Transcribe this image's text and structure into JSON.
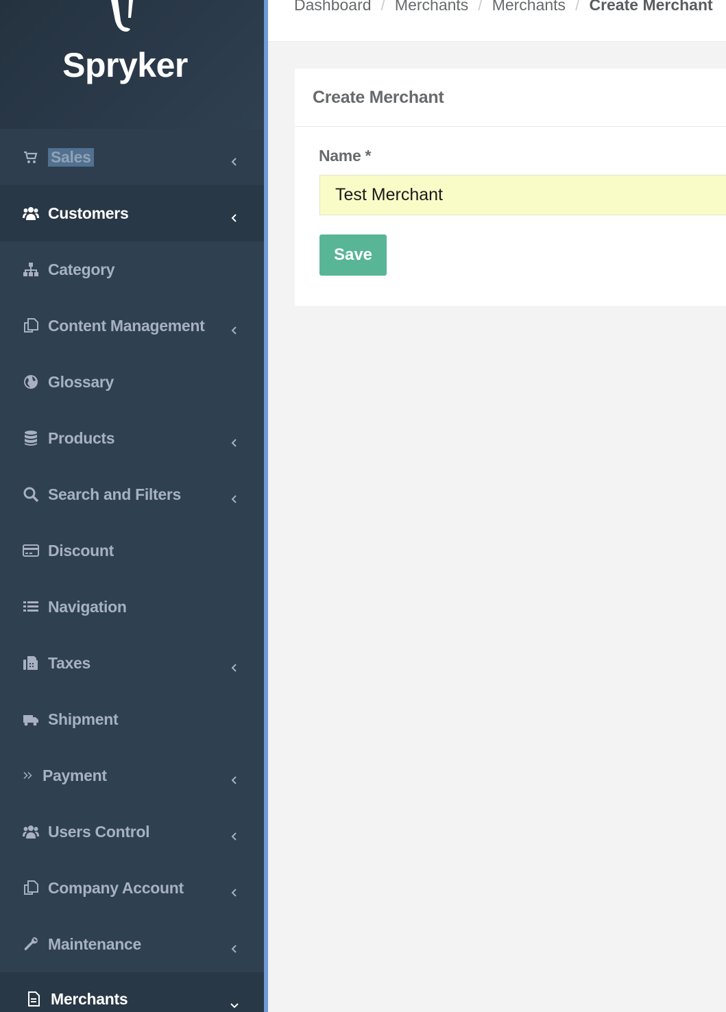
{
  "brand": {
    "name": "Spryker"
  },
  "breadcrumb": [
    "Dashboard",
    "Merchants",
    "Merchants",
    "Create Merchant"
  ],
  "sidebar": {
    "items": [
      {
        "label": "Sales",
        "icon": "cart-icon",
        "has_children": true
      },
      {
        "label": "Customers",
        "icon": "users-icon",
        "has_children": true
      },
      {
        "label": "Category",
        "icon": "sitemap-icon",
        "has_children": false
      },
      {
        "label": "Content Management",
        "icon": "copy-icon",
        "has_children": true
      },
      {
        "label": "Glossary",
        "icon": "globe-icon",
        "has_children": false
      },
      {
        "label": "Products",
        "icon": "database-icon",
        "has_children": true
      },
      {
        "label": "Search and Filters",
        "icon": "search-icon",
        "has_children": true
      },
      {
        "label": "Discount",
        "icon": "credit-card-icon",
        "has_children": false
      },
      {
        "label": "Navigation",
        "icon": "list-icon",
        "has_children": false
      },
      {
        "label": "Taxes",
        "icon": "fax-icon",
        "has_children": true
      },
      {
        "label": "Shipment",
        "icon": "truck-icon",
        "has_children": false
      },
      {
        "label": "Payment",
        "icon": "double-chevron-right-icon",
        "has_children": true
      },
      {
        "label": "Users Control",
        "icon": "users-icon",
        "has_children": true
      },
      {
        "label": "Company Account",
        "icon": "copy-icon",
        "has_children": true
      },
      {
        "label": "Maintenance",
        "icon": "wrench-icon",
        "has_children": true
      },
      {
        "label": "Merchants",
        "icon": "file-icon",
        "has_children": true,
        "expanded": true
      }
    ]
  },
  "panel": {
    "title": "Create Merchant",
    "name_label": "Name",
    "required_mark": "*",
    "name_value": "Test Merchant",
    "save_label": "Save"
  },
  "colors": {
    "sidebar_bg": "#2f4050",
    "save_button": "#58b595",
    "input_autofill": "#fafcc8"
  }
}
